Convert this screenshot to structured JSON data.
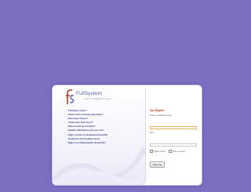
{
  "logo": {
    "name": "FullSystem",
    "tagline": "Kolay Ön Muhasebe Programı",
    "mark": "fs"
  },
  "faq": {
    "items": [
      "FullSistem nedir?",
      "Kimler ürün yönetimi yapmalıdır?",
      "Nasıl kayıt olunur?",
      "Yazılım kaç ticari içerir?",
      "Neler ücretli bir hizmettir?",
      "Hatalar kullanıcılara yansıyor mu?",
      "Diğer sorular ve hesaplanacak fiyatlar",
      "Kurlarımız ürün fiyatları nasıl?",
      "Diğer ve evrakkişmetleri kimdendir?"
    ]
  },
  "login": {
    "title": "Üye Bilgileri",
    "username_label": "Kullanıcı Adı/Şirket Kodu",
    "username_value": "",
    "password_label": "Şifre",
    "password_value": "",
    "remember_label": "Bilgileri Hatırla",
    "forgot_label": "Şifremi Unuttum",
    "submit_label": "Giriş Yap"
  },
  "colors": {
    "background": "#7b6ec0",
    "title_red": "#c0392b",
    "link_blue": "#3b3b8a"
  }
}
